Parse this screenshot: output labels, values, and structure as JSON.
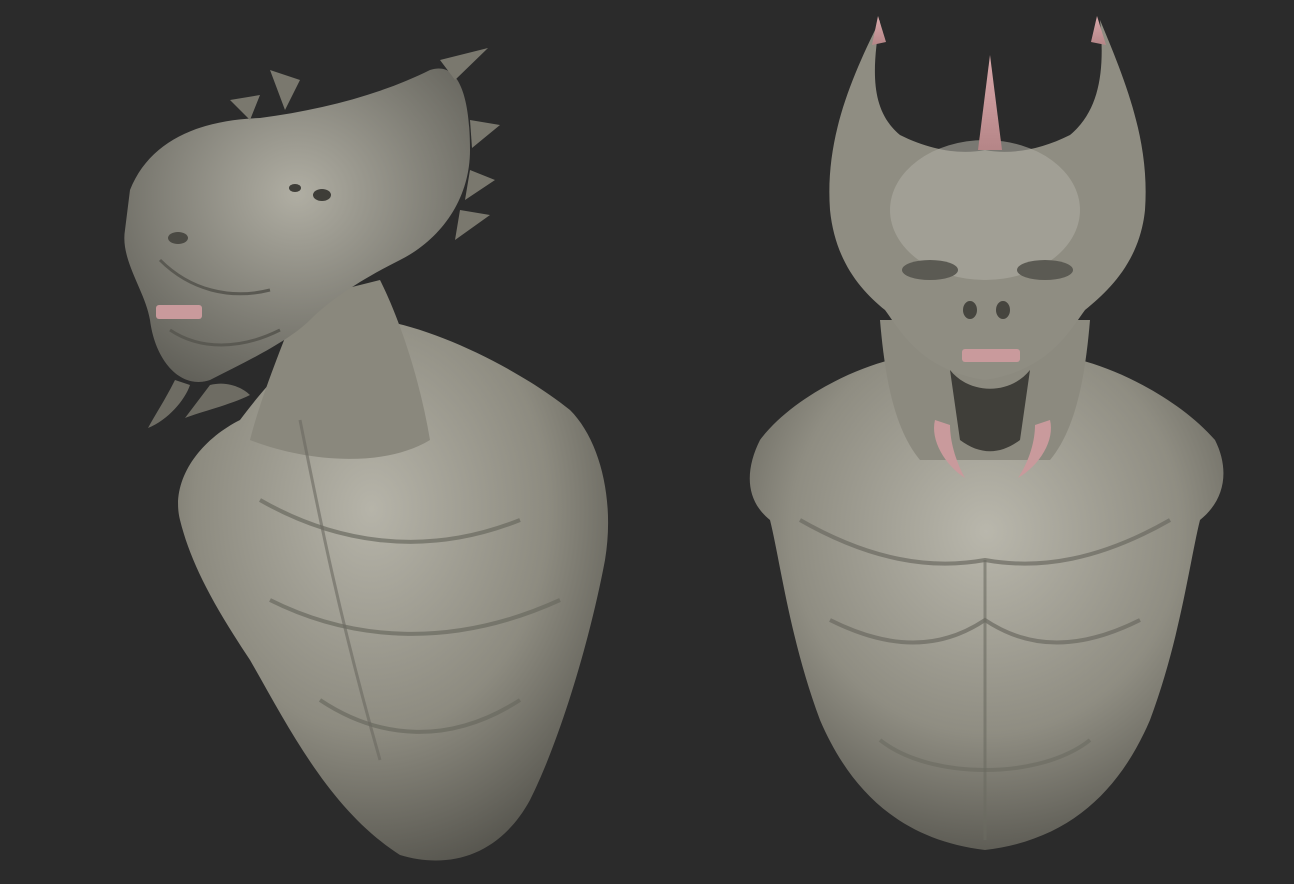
{
  "scene": {
    "background_color": "#2b2b2b",
    "clay_color": "#8d8b80",
    "clay_highlight": "#b6b4a9",
    "clay_shadow": "#4a4943",
    "accent_color": "#c99a9c",
    "views": [
      {
        "name": "three-quarter-view"
      },
      {
        "name": "front-view"
      }
    ]
  }
}
